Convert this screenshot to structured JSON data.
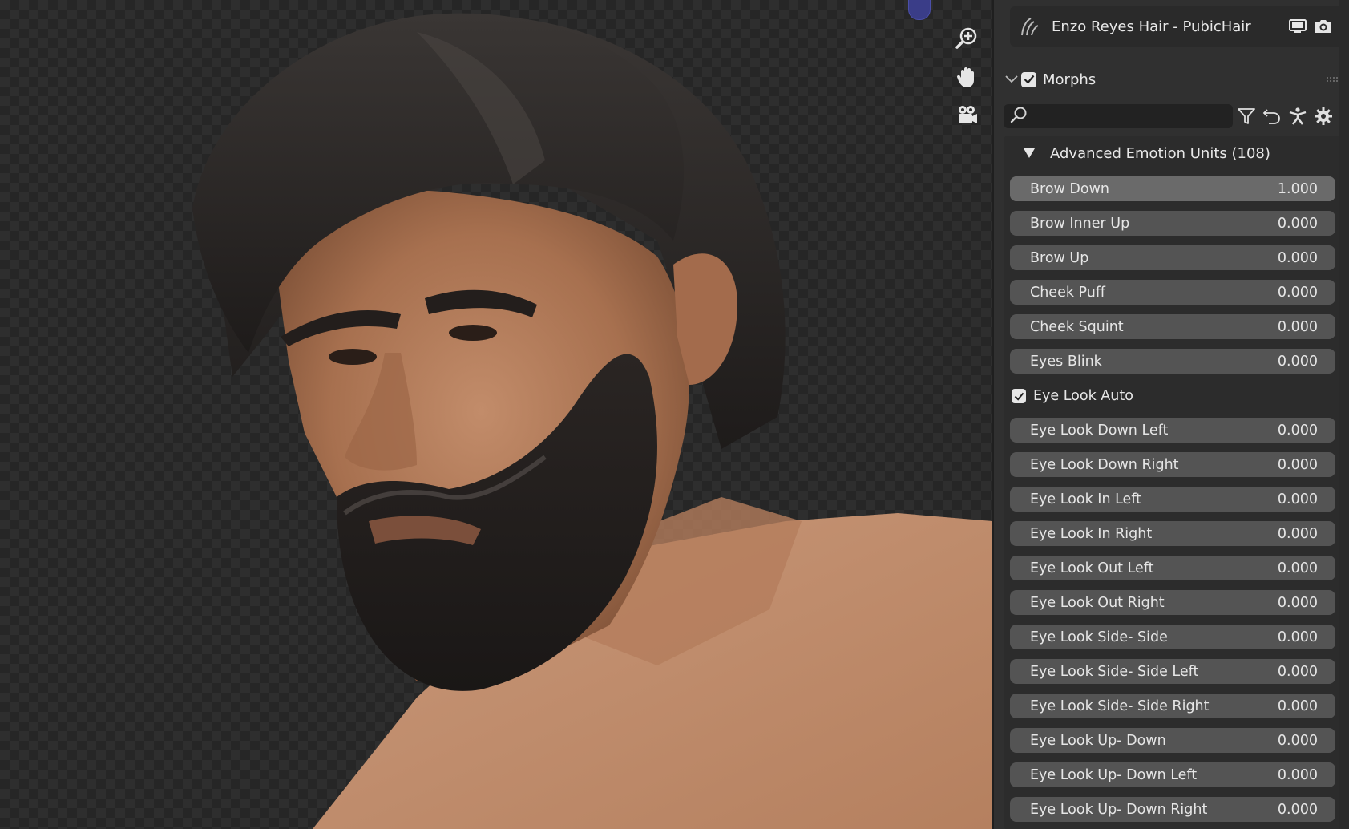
{
  "object_header": {
    "name": "Enzo Reyes Hair - PubicHair",
    "icon": "hair-curves-icon",
    "toggles": [
      "monitor-icon",
      "camera-icon"
    ]
  },
  "viewport": {
    "nav_buttons": [
      "zoom-icon",
      "hand-pan-icon",
      "camera-view-icon"
    ]
  },
  "morphs_panel": {
    "title": "Morphs",
    "enabled": true,
    "search": {
      "value": "",
      "placeholder": ""
    },
    "tools": [
      "filter-icon",
      "undo-icon",
      "pose-icon",
      "settings-icon"
    ],
    "group": {
      "title": "Advanced Emotion Units (108)",
      "expanded": true
    },
    "rows": [
      {
        "type": "slider",
        "label": "Brow Down",
        "value": "1.000",
        "fraction": 1.0
      },
      {
        "type": "slider",
        "label": "Brow Inner Up",
        "value": "0.000",
        "fraction": 0
      },
      {
        "type": "slider",
        "label": "Brow Up",
        "value": "0.000",
        "fraction": 0
      },
      {
        "type": "slider",
        "label": "Cheek Puff",
        "value": "0.000",
        "fraction": 0
      },
      {
        "type": "slider",
        "label": "Cheek Squint",
        "value": "0.000",
        "fraction": 0
      },
      {
        "type": "slider",
        "label": "Eyes Blink",
        "value": "0.000",
        "fraction": 0
      },
      {
        "type": "checkbox",
        "label": "Eye Look Auto",
        "checked": true
      },
      {
        "type": "slider",
        "label": "Eye Look Down Left",
        "value": "0.000",
        "fraction": 0
      },
      {
        "type": "slider",
        "label": "Eye Look Down Right",
        "value": "0.000",
        "fraction": 0
      },
      {
        "type": "slider",
        "label": "Eye Look In Left",
        "value": "0.000",
        "fraction": 0
      },
      {
        "type": "slider",
        "label": "Eye Look In Right",
        "value": "0.000",
        "fraction": 0
      },
      {
        "type": "slider",
        "label": "Eye Look Out Left",
        "value": "0.000",
        "fraction": 0
      },
      {
        "type": "slider",
        "label": "Eye Look Out Right",
        "value": "0.000",
        "fraction": 0
      },
      {
        "type": "slider",
        "label": "Eye Look Side- Side",
        "value": "0.000",
        "fraction": 0
      },
      {
        "type": "slider",
        "label": "Eye Look Side- Side Left",
        "value": "0.000",
        "fraction": 0
      },
      {
        "type": "slider",
        "label": "Eye Look Side- Side Right",
        "value": "0.000",
        "fraction": 0
      },
      {
        "type": "slider",
        "label": "Eye Look Up- Down",
        "value": "0.000",
        "fraction": 0
      },
      {
        "type": "slider",
        "label": "Eye Look Up- Down Left",
        "value": "0.000",
        "fraction": 0
      },
      {
        "type": "slider",
        "label": "Eye Look Up- Down Right",
        "value": "0.000",
        "fraction": 0
      }
    ]
  },
  "colors": {
    "panel_bg": "#303030",
    "slider_bg": "#545454",
    "slider_fill": "#6a6a6a",
    "axis_dot": "#3a3d88"
  }
}
